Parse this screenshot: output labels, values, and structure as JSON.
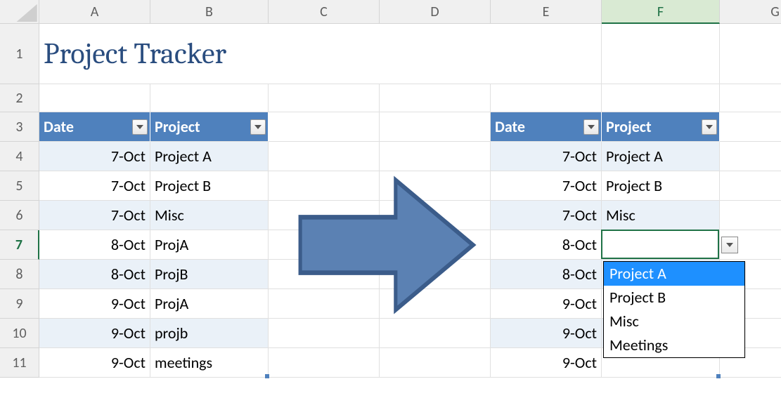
{
  "title": "Project Tracker",
  "columns": [
    {
      "letter": "A",
      "width": 158
    },
    {
      "letter": "B",
      "width": 168
    },
    {
      "letter": "C",
      "width": 158
    },
    {
      "letter": "D",
      "width": 158
    },
    {
      "letter": "E",
      "width": 158
    },
    {
      "letter": "F",
      "width": 168
    },
    {
      "letter": "G",
      "width": 158
    }
  ],
  "active_column_index": 5,
  "rows": [
    {
      "num": "1",
      "height": 86
    },
    {
      "num": "2",
      "height": 40
    },
    {
      "num": "3",
      "height": 42
    },
    {
      "num": "4",
      "height": 42
    },
    {
      "num": "5",
      "height": 42
    },
    {
      "num": "6",
      "height": 42
    },
    {
      "num": "7",
      "height": 42
    },
    {
      "num": "8",
      "height": 42
    },
    {
      "num": "9",
      "height": 42
    },
    {
      "num": "10",
      "height": 42
    },
    {
      "num": "11",
      "height": 42
    }
  ],
  "active_row_index": 6,
  "left_table": {
    "headers": [
      "Date",
      "Project"
    ],
    "rows": [
      {
        "date": "7-Oct",
        "project": "Project A"
      },
      {
        "date": "7-Oct",
        "project": "Project B"
      },
      {
        "date": "7-Oct",
        "project": "Misc"
      },
      {
        "date": "8-Oct",
        "project": "ProjA"
      },
      {
        "date": "8-Oct",
        "project": "ProjB"
      },
      {
        "date": "9-Oct",
        "project": "ProjA"
      },
      {
        "date": "9-Oct",
        "project": "projb"
      },
      {
        "date": "9-Oct",
        "project": "meetings"
      }
    ]
  },
  "right_table": {
    "headers": [
      "Date",
      "Project"
    ],
    "rows": [
      {
        "date": "7-Oct",
        "project": "Project A"
      },
      {
        "date": "7-Oct",
        "project": "Project B"
      },
      {
        "date": "7-Oct",
        "project": "Misc"
      },
      {
        "date": "8-Oct",
        "project": ""
      },
      {
        "date": "8-Oct",
        "project": ""
      },
      {
        "date": "9-Oct",
        "project": ""
      },
      {
        "date": "9-Oct",
        "project": ""
      },
      {
        "date": "9-Oct",
        "project": ""
      }
    ]
  },
  "dropdown": {
    "selected_index": 0,
    "options": [
      "Project A",
      "Project B",
      "Misc",
      "Meetings"
    ]
  },
  "colors": {
    "table_header_bg": "#4f81bd",
    "band_even": "#eaf1f8",
    "title_color": "#2a4d7f",
    "arrow_fill": "#5b81b3",
    "arrow_stroke": "#3b5c8a",
    "selection": "#1f7246"
  }
}
